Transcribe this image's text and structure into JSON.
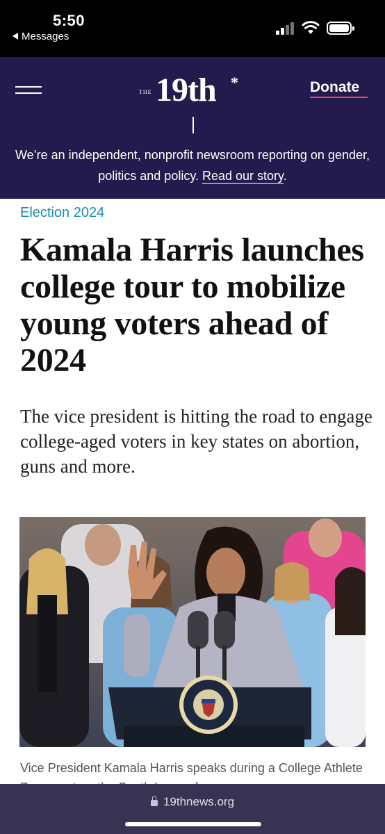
{
  "status_bar": {
    "time": "5:50",
    "back_label": "Messages"
  },
  "header": {
    "logo_prefix": "THE",
    "logo_main": "19th",
    "logo_star": "*",
    "donate_label": "Donate",
    "tagline_part1": "We’re an independent, nonprofit newsroom reporting on gender, politics and policy. ",
    "tagline_link": "Read our story",
    "tagline_end": "."
  },
  "article": {
    "category": "Election 2024",
    "headline": "Kamala Harris launches college tour to mobilize young voters ahead of 2024",
    "dek": "The vice president is hitting the road to engage college-aged voters in key states on abortion, guns and more.",
    "caption": "Vice President Kamala Harris speaks during a College Athlete Day event on the South Lawn of",
    "seal_text": "VICE PRESIDENT OF THE UNITED STATES"
  },
  "browser": {
    "url": "19thnews.org"
  },
  "colors": {
    "header_bg": "#231b4d",
    "category": "#1a8fb0",
    "donate_underline": "#e8437c",
    "link_underline": "#58b4d1"
  }
}
